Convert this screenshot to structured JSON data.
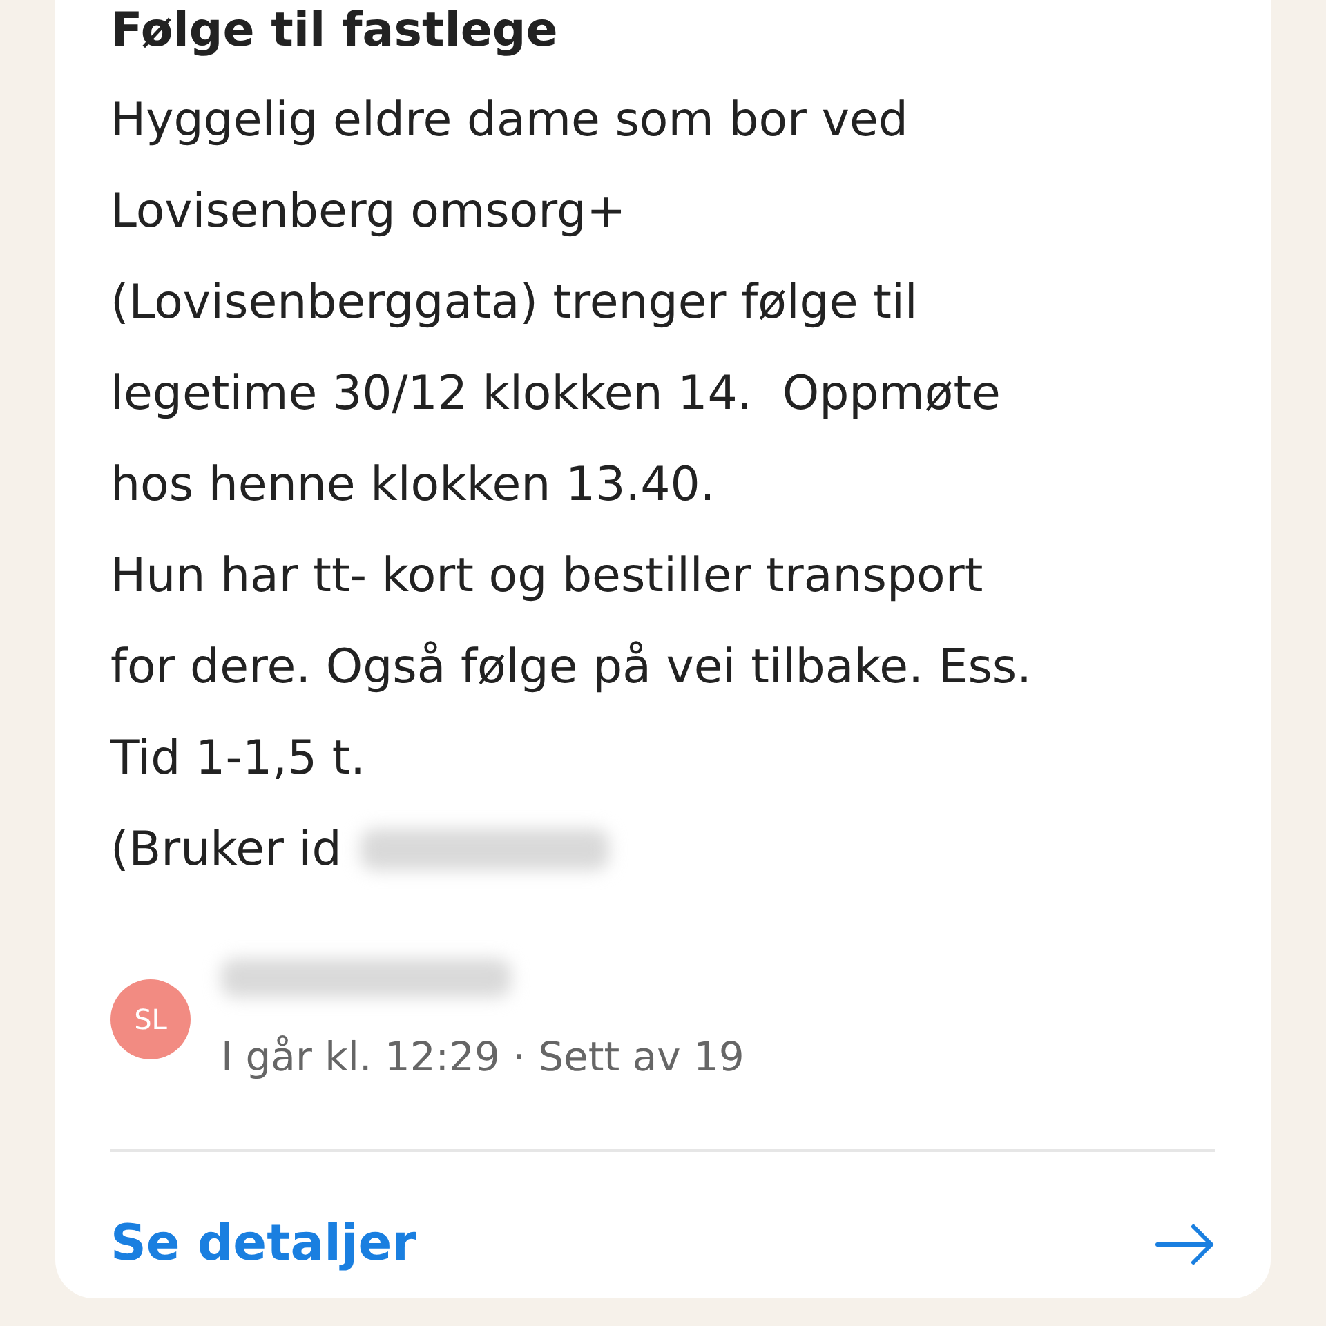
{
  "title": "Følge til fastlege",
  "description": "Hyggelig eldre dame som bor ved\nLovisenberg omsorg+\n(Lovisenberggata) trenger følge til\nlegetime 30/12 klokken 14.  Oppmøte\nhos henne klokken 13.40.\nHun har tt- kort og bestiller transport\nfor dere. Også følge på vei tilbake. Ess.\nTid 1-1,5 t.",
  "user_id_label": "(Bruker id",
  "author": {
    "initials": "SL",
    "color": "#f28b82",
    "meta": "I går kl. 12:29 · Sett av 19"
  },
  "details_link": "Se detaljer"
}
